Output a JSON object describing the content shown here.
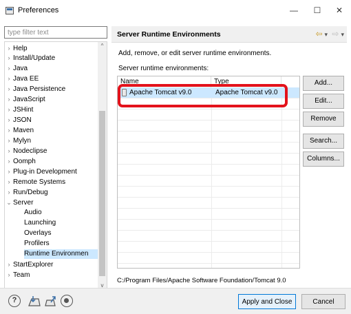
{
  "window": {
    "title": "Preferences",
    "minimize": "—",
    "maximize": "☐",
    "close": "✕"
  },
  "sidebar": {
    "filter_placeholder": "type filter text",
    "items": [
      {
        "label": "Help",
        "expander": "›"
      },
      {
        "label": "Install/Update",
        "expander": "›"
      },
      {
        "label": "Java",
        "expander": "›"
      },
      {
        "label": "Java EE",
        "expander": "›"
      },
      {
        "label": "Java Persistence",
        "expander": "›"
      },
      {
        "label": "JavaScript",
        "expander": "›"
      },
      {
        "label": "JSHint",
        "expander": "›"
      },
      {
        "label": "JSON",
        "expander": "›"
      },
      {
        "label": "Maven",
        "expander": "›"
      },
      {
        "label": "Mylyn",
        "expander": "›"
      },
      {
        "label": "Nodeclipse",
        "expander": "›"
      },
      {
        "label": "Oomph",
        "expander": "›"
      },
      {
        "label": "Plug-in Development",
        "expander": "›"
      },
      {
        "label": "Remote Systems",
        "expander": "›"
      },
      {
        "label": "Run/Debug",
        "expander": "›"
      },
      {
        "label": "Server",
        "expander": "⌄"
      },
      {
        "label": "Audio",
        "expander": ""
      },
      {
        "label": "Launching",
        "expander": ""
      },
      {
        "label": "Overlays",
        "expander": ""
      },
      {
        "label": "Profilers",
        "expander": ""
      },
      {
        "label": "Runtime Environmen",
        "expander": ""
      },
      {
        "label": "StartExplorer",
        "expander": "›"
      },
      {
        "label": "Team",
        "expander": "›"
      }
    ],
    "scroll_up": "^",
    "scroll_down": "v",
    "scroll_left": "<",
    "scroll_right": ">"
  },
  "main": {
    "title": "Server Runtime Environments",
    "nav_icons": {
      "back": "⇦",
      "back_menu": "▾",
      "forward": "⇨",
      "forward_menu": "▾"
    },
    "description": "Add, remove, or edit server runtime environments.",
    "list_label": "Server runtime environments:",
    "columns": [
      "Name",
      "Type"
    ],
    "rows": [
      {
        "name": "Apache Tomcat v9.0",
        "type": "Apache Tomcat v9.0"
      }
    ],
    "buttons": {
      "add": "Add...",
      "edit": "Edit...",
      "remove": "Remove",
      "search": "Search...",
      "columns": "Columns..."
    },
    "location": "C:/Program Files/Apache Software Foundation/Tomcat 9.0"
  },
  "footer": {
    "help_glyph": "?",
    "apply_close": "Apply and Close",
    "cancel": "Cancel"
  },
  "colors": {
    "highlight_box": "#e3121b",
    "selection": "#cce8ff",
    "default_button_border": "#0078d7"
  }
}
